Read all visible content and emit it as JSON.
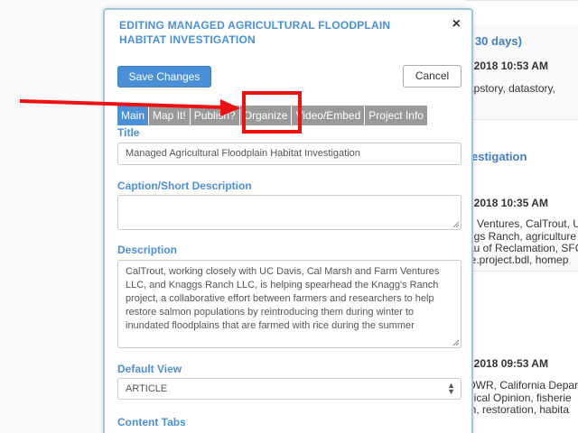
{
  "background": {
    "snippets": [
      {
        "text": "( 30 days)",
        "style": "bg-blue"
      },
      {
        "text": ", 2018 10:53 AM",
        "style": "bg-bold"
      },
      {
        "text": "apstory, datastory,",
        "style": ""
      },
      {
        "text": "estigation",
        "style": "bg-blue"
      },
      {
        "text": ", 2018 10:35 AM",
        "style": "bg-bold"
      },
      {
        "text": "n Ventures, CalTrout, U",
        "style": ""
      },
      {
        "text": "ggs Ranch, agriculture",
        "style": ""
      },
      {
        "text": "au of Reclamation, SFC",
        "style": ""
      },
      {
        "text": "le.project.bdl, homep",
        "style": ""
      },
      {
        "text": ", 2018 09:53 AM",
        "style": "bg-bold"
      },
      {
        "text": "DWR, California Depar",
        "style": ""
      },
      {
        "text": "gical Opinion, fisherie",
        "style": ""
      },
      {
        "text": "in, restoration, habita",
        "style": ""
      }
    ]
  },
  "modal": {
    "title": "EDITING MANAGED AGRICULTURAL FLOODPLAIN HABITAT INVESTIGATION",
    "close_label": "×",
    "save_label": "Save Changes",
    "cancel_label": "Cancel",
    "tabs": [
      {
        "label": "Main"
      },
      {
        "label": "Map It!"
      },
      {
        "label": "Publish?"
      },
      {
        "label": "Organize"
      },
      {
        "label": "Video/Embed"
      },
      {
        "label": "Project Info"
      }
    ],
    "fields": {
      "title_label": "Title",
      "title_value": "Managed Agricultural Floodplain Habitat Investigation",
      "caption_label": "Caption/Short Description",
      "caption_value": "",
      "description_label": "Description",
      "description_value": "CalTrout, working closely with UC Davis, Cal Marsh and Farm Ventures LLC, and Knaggs Ranch LLC, is helping spearhead the Knagg's Ranch project, a collaborative effort between farmers and researchers to help restore salmon populations by reintroducing them during winter to inundated floodplains that are farmed with rice during the summer",
      "default_view_label": "Default View",
      "default_view_value": "ARTICLE",
      "content_tabs_label": "Content Tabs"
    }
  },
  "colors": {
    "accent": "#4a90d9",
    "tab_inactive": "#999999",
    "annotation": "#ee1111"
  }
}
